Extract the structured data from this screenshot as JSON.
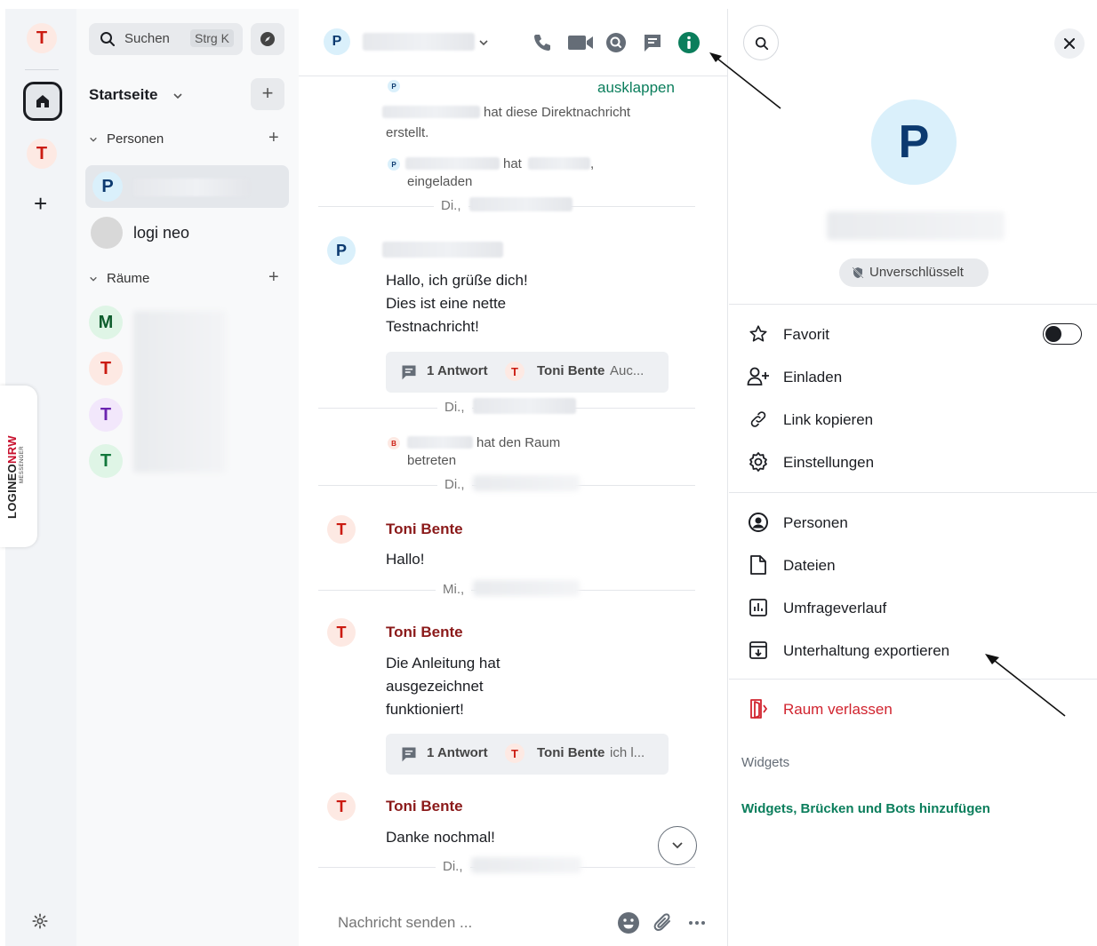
{
  "spaces": {
    "user_initial": "T",
    "space_initial": "T",
    "add_symbol": "+",
    "logo_main_a": "LOGINEO",
    "logo_main_b": "NRW",
    "logo_sub": "MESSENGER"
  },
  "roomlist": {
    "search_label": "Suchen",
    "search_shortcut": "Strg K",
    "home_title": "Startseite",
    "add_symbol": "+",
    "people_section": "Personen",
    "rooms_section": "Räume",
    "people": [
      {
        "initial": "P"
      },
      {
        "name": "logi neo"
      }
    ],
    "rooms": [
      {
        "initial": "M"
      },
      {
        "initial": "T"
      },
      {
        "initial": "T"
      },
      {
        "initial": "T"
      }
    ]
  },
  "timeline": {
    "header_initial": "P",
    "expand_link": "ausklappen",
    "event_created": "hat diese Direktnachricht",
    "event_created_2": "erstellt.",
    "event_invited_prefix": "hat",
    "event_invited_suffix": ",",
    "event_invited_2": "eingeladen",
    "day_prefix_tue": "Di.,",
    "day_prefix_wed": "Mi.,",
    "msg1_initial": "P",
    "msg1_lines": [
      "Hallo, ich grüße dich!",
      "Dies ist eine nette",
      "Testnachricht!"
    ],
    "thread1_count": "1 Antwort",
    "thread1_initial": "T",
    "thread1_author": "Toni Bente",
    "thread1_preview": "Auc...",
    "event_joined_initial": "B",
    "event_joined": "hat den Raum",
    "event_joined_2": "betreten",
    "msg2_author": "Toni Bente",
    "msg2_initial": "T",
    "msg2_text": "Hallo!",
    "msg3_author": "Toni Bente",
    "msg3_initial": "T",
    "msg3_lines": [
      "Die Anleitung hat",
      "ausgezeichnet",
      "funktioniert!"
    ],
    "thread2_count": "1 Antwort",
    "thread2_initial": "T",
    "thread2_author": "Toni Bente",
    "thread2_preview": "ich l...",
    "msg4_author": "Toni Bente",
    "msg4_initial": "T",
    "msg4_text": "Danke nochmal!",
    "composer_placeholder": "Nachricht senden ..."
  },
  "rightpanel": {
    "room_initial": "P",
    "encryption_badge": "Unverschlüsselt",
    "menu_favorite": "Favorit",
    "favorite_enabled": false,
    "menu_invite": "Einladen",
    "menu_copy_link": "Link kopieren",
    "menu_settings": "Einstellungen",
    "menu_people": "Personen",
    "menu_files": "Dateien",
    "menu_polls": "Umfrageverlauf",
    "menu_export": "Unterhaltung exportieren",
    "menu_leave": "Raum verlassen",
    "widgets_heading": "Widgets",
    "widgets_link": "Widgets, Brücken und Bots hinzufügen"
  },
  "colors": {
    "accent_green": "#0b7e5c",
    "danger_red": "#d1242f",
    "author_red": "#8b1a1a"
  }
}
